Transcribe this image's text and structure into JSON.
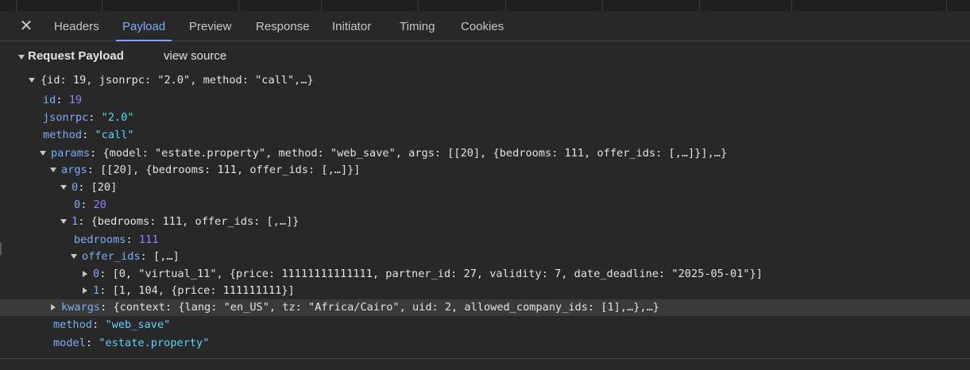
{
  "tabs": {
    "close_icon": "close-icon",
    "items": [
      "Headers",
      "Payload",
      "Preview",
      "Response",
      "Initiator",
      "Timing",
      "Cookies"
    ],
    "active": "Payload"
  },
  "payload": {
    "title": "Request Payload",
    "view_source": "view source"
  },
  "tree": {
    "root": "{id: 19, jsonrpc: \"2.0\", method: \"call\",…}",
    "id_key": "id",
    "id_val": "19",
    "jsonrpc_key": "jsonrpc",
    "jsonrpc_val": "\"2.0\"",
    "method_key": "method",
    "method_val": "\"call\"",
    "params_key": "params",
    "params_preview": "{model: \"estate.property\", method: \"web_save\", args: [[20], {bedrooms: 111, offer_ids: [,…]}],…}",
    "args_key": "args",
    "args_preview": "[[20], {bedrooms: 111, offer_ids: [,…]}]",
    "a0_key": "0",
    "a0_preview": "[20]",
    "a0_0_key": "0",
    "a0_0_val": "20",
    "a1_key": "1",
    "a1_preview": "{bedrooms: 111, offer_ids: [,…]}",
    "bedrooms_key": "bedrooms",
    "bedrooms_val": "111",
    "offer_key": "offer_ids",
    "offer_preview": "[,…]",
    "o0_key": "0",
    "o0_preview": "[0, \"virtual_11\", {price: 11111111111111, partner_id: 27, validity: 7, date_deadline: \"2025-05-01\"}]",
    "o1_key": "1",
    "o1_preview": "[1, 104, {price: 111111111}]",
    "kwargs_key": "kwargs",
    "kwargs_preview": "{context: {lang: \"en_US\", tz: \"Africa/Cairo\", uid: 2, allowed_company_ids: [1],…},…}",
    "pmethod_key": "method",
    "pmethod_val": "\"web_save\"",
    "model_key": "model",
    "model_val": "\"estate.property\""
  }
}
